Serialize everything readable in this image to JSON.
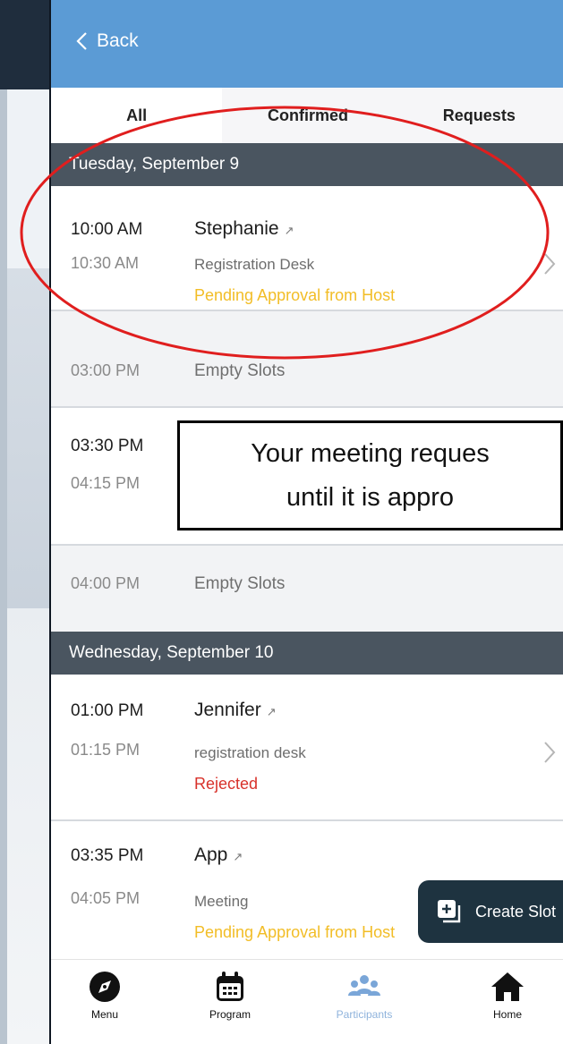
{
  "header": {
    "back_label": "Back"
  },
  "tabs": [
    {
      "label": "All",
      "active": true
    },
    {
      "label": "Confirmed",
      "active": false
    },
    {
      "label": "Requests",
      "active": false
    }
  ],
  "days": [
    {
      "label": "Tuesday, September 9",
      "slots": [
        {
          "start": "10:00 AM",
          "end": "10:30 AM",
          "name": "Stephanie",
          "location": "Registration Desk",
          "status": "Pending Approval from Host",
          "status_kind": "pending"
        },
        {
          "start": "03:00 PM",
          "label": "Empty Slots",
          "kind": "empty"
        },
        {
          "start": "03:30 PM",
          "end": "04:15 PM"
        },
        {
          "start": "04:00 PM",
          "label": "Empty Slots",
          "kind": "empty"
        }
      ]
    },
    {
      "label": "Wednesday, September 10",
      "slots": [
        {
          "start": "01:00 PM",
          "end": "01:15 PM",
          "name": "Jennifer",
          "location": "registration desk",
          "status": "Rejected",
          "status_kind": "rejected"
        },
        {
          "start": "03:35 PM",
          "end": "04:05 PM",
          "name": "App",
          "location": "Meeting",
          "status": "Pending Approval from Host",
          "status_kind": "pending"
        }
      ]
    }
  ],
  "callout": {
    "line1": "Your meeting reques",
    "line2": "until it is appro"
  },
  "create_slot": {
    "label": "Create Slot"
  },
  "bottom_nav": [
    {
      "label": "Menu",
      "icon": "compass-icon"
    },
    {
      "label": "Program",
      "icon": "calendar-icon"
    },
    {
      "label": "Participants",
      "icon": "people-icon",
      "active": true
    },
    {
      "label": "Home",
      "icon": "home-icon"
    }
  ],
  "colors": {
    "header_blue": "#5b9bd5",
    "day_header": "#4a5560",
    "pending": "#f2bd26",
    "rejected": "#d8322b",
    "annotation_red": "#e01e1e",
    "create_slot_bg": "#1e3340"
  }
}
